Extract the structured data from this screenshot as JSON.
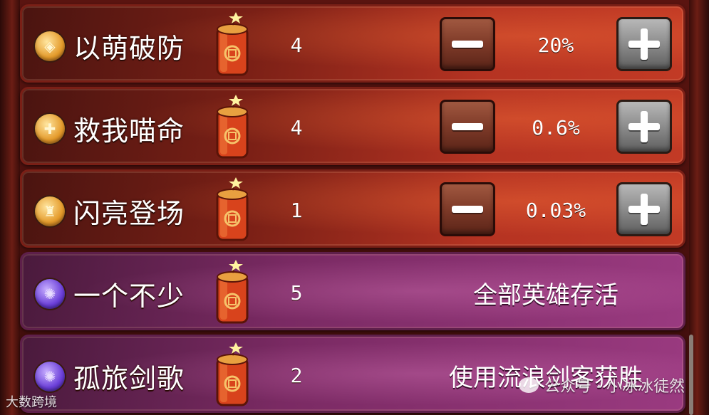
{
  "rows": [
    {
      "title": "以萌破防",
      "count": "4",
      "value": "20%",
      "badge": "shield-icon",
      "badge_glyph": "◈",
      "theme": "red"
    },
    {
      "title": "救我喵命",
      "count": "4",
      "value": "0.6%",
      "badge": "heal-icon",
      "badge_glyph": "✚",
      "theme": "red"
    },
    {
      "title": "闪亮登场",
      "count": "1",
      "value": "0.03%",
      "badge": "bell-icon",
      "badge_glyph": "♜",
      "theme": "red"
    },
    {
      "title": "一个不少",
      "count": "5",
      "desc": "全部英雄存活",
      "badge": "violet-orb-icon",
      "badge_glyph": "✺",
      "theme": "purple"
    },
    {
      "title": "孤旅剑歌",
      "count": "2",
      "desc": "使用流浪剑客获胜",
      "badge": "violet-orb-icon",
      "badge_glyph": "✺",
      "theme": "purple"
    }
  ],
  "watermark": {
    "left": "大数跨境",
    "right": "公众号 · 小冰冰徒然"
  },
  "colors": {
    "row_red": "#b53322",
    "row_purple": "#7a2a63",
    "text": "#ffffff"
  }
}
